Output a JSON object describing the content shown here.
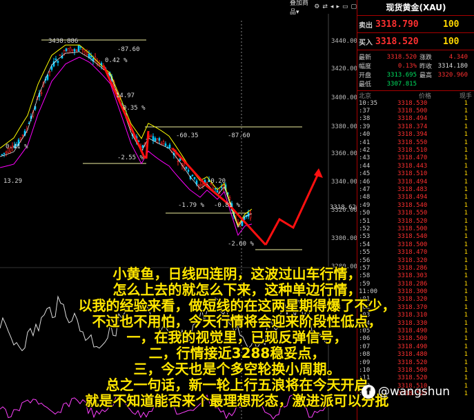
{
  "toolbar": {
    "indicator_label": "叠加商品▾",
    "icons": [
      "gear-icon",
      "swap-icon",
      "prev-icon",
      "next-icon",
      "expand-icon",
      "collapse-icon"
    ]
  },
  "chart": {
    "y_ticks": [
      "3440.000",
      "3420.000",
      "3400.000",
      "3380.000",
      "3360.000",
      "3340.000",
      "3320.000",
      "3300.000",
      "3280.000"
    ],
    "current_price": "3318.626",
    "price_labels": [
      "3438.886",
      "-87.60",
      "0.42 %",
      "14.97",
      "0.35 %",
      "0.41 %",
      "-2.55 %",
      "-60.35",
      "-87.60",
      "13.29",
      "-0.20",
      "-1.79 %",
      "-0.81 %",
      "-2.60 %"
    ],
    "colors": {
      "up": "#ff2020",
      "down": "#00c8ff",
      "ma1": "#ffff00",
      "ma2": "#ff00ff",
      "level": "#f0f0a0",
      "arrow": "#ff1010"
    }
  },
  "quote": {
    "title": "现货黄金(XAU)",
    "sell_label": "卖出",
    "sell_price": "3318.790",
    "sell_qty": "100",
    "buy_label": "买入",
    "buy_price": "3318.520",
    "buy_qty": "100",
    "stats": [
      {
        "k": "最新",
        "v": "3318.520",
        "vc": "red",
        "k2": "涨跌",
        "v2": "4.340",
        "v2c": "red"
      },
      {
        "k": "幅度",
        "v": "0.13%",
        "vc": "red",
        "k2": "昨收",
        "v2": "3314.180",
        "v2c": "white"
      },
      {
        "k": "开盘",
        "v": "3313.695",
        "vc": "green",
        "k2": "最高",
        "v2": "3320.960",
        "v2c": "red"
      },
      {
        "k": "最低",
        "v": "3307.815",
        "vc": "green",
        "k2": "",
        "v2": "",
        "v2c": "white"
      }
    ],
    "ticks_header": [
      "北京",
      "价格",
      "现手"
    ],
    "ticks": [
      {
        "t": "10:35",
        "p": "3318.530",
        "v": "1"
      },
      {
        "t": ":37",
        "p": "3318.500",
        "v": "1"
      },
      {
        "t": ":38",
        "p": "3318.494",
        "v": "1"
      },
      {
        "t": ":39",
        "p": "3318.374",
        "v": "1"
      },
      {
        "t": ":40",
        "p": "3318.394",
        "v": "1"
      },
      {
        "t": ":41",
        "p": "3318.550",
        "v": "1"
      },
      {
        "t": ":42",
        "p": "3318.510",
        "v": "1"
      },
      {
        "t": ":43",
        "p": "3318.470",
        "v": "1"
      },
      {
        "t": ":44",
        "p": "3318.443",
        "v": "1"
      },
      {
        "t": ":45",
        "p": "3318.510",
        "v": "1"
      },
      {
        "t": ":46",
        "p": "3318.494",
        "v": "1"
      },
      {
        "t": ":47",
        "p": "3318.483",
        "v": "1"
      },
      {
        "t": ":48",
        "p": "3318.494",
        "v": "1"
      },
      {
        "t": ":49",
        "p": "3318.540",
        "v": "1"
      },
      {
        "t": ":50",
        "p": "3318.550",
        "v": "1"
      },
      {
        "t": ":51",
        "p": "3318.520",
        "v": "1"
      },
      {
        "t": ":52",
        "p": "3318.500",
        "v": "1"
      },
      {
        "t": ":53",
        "p": "3318.540",
        "v": "1"
      },
      {
        "t": ":54",
        "p": "3318.500",
        "v": "1"
      },
      {
        "t": ":55",
        "p": "3318.470",
        "v": "1"
      },
      {
        "t": ":56",
        "p": "3318.320",
        "v": "1"
      },
      {
        "t": ":57",
        "p": "3318.286",
        "v": "1"
      },
      {
        "t": ":58",
        "p": "3318.303",
        "v": "1"
      },
      {
        "t": ":59",
        "p": "3318.286",
        "v": "1"
      },
      {
        "t": "11:00",
        "p": "3318.300",
        "v": "1"
      },
      {
        "t": ":01",
        "p": "3318.320",
        "v": "1"
      },
      {
        "t": ":02",
        "p": "3318.370",
        "v": "1"
      },
      {
        "t": ":03",
        "p": "3318.310",
        "v": "1"
      },
      {
        "t": ":04",
        "p": "3318.330",
        "v": "1"
      },
      {
        "t": ":05",
        "p": "3318.490",
        "v": "1"
      },
      {
        "t": ":06",
        "p": "3318.500",
        "v": "1"
      },
      {
        "t": ":07",
        "p": "3318.490",
        "v": "1"
      },
      {
        "t": ":08",
        "p": "3318.480",
        "v": "1"
      },
      {
        "t": ":09",
        "p": "3318.520",
        "v": "1"
      },
      {
        "t": ":10",
        "p": "3318.500",
        "v": "1"
      },
      {
        "t": ":11",
        "p": "3318.520",
        "v": "1"
      },
      {
        "t": ":12",
        "p": "3318.510",
        "v": "1"
      },
      {
        "t": ":13",
        "p": "3318.520",
        "v": "1"
      }
    ]
  },
  "caption": [
    "小黄鱼，日线四连阴，这波过山车行情，",
    "怎么上去的就怎么下来，这种单边行情，",
    "以我的经验来看，做短线的在这两星期得爆了不少，",
    "不过也不用怕，今天行情将会迎来阶段性低点，",
    "一，在我的视觉里，已现反弹信号，",
    "二，行情接近3288稳妥点，",
    "三，今天也是个多空轮换小周期。",
    "总之一句话，新一轮上行五浪将在今天开启",
    "就是不知道能否来个最理想形态，激进派可以分批"
  ],
  "watermark": {
    "text": "@wangshun",
    "logo": "f"
  }
}
